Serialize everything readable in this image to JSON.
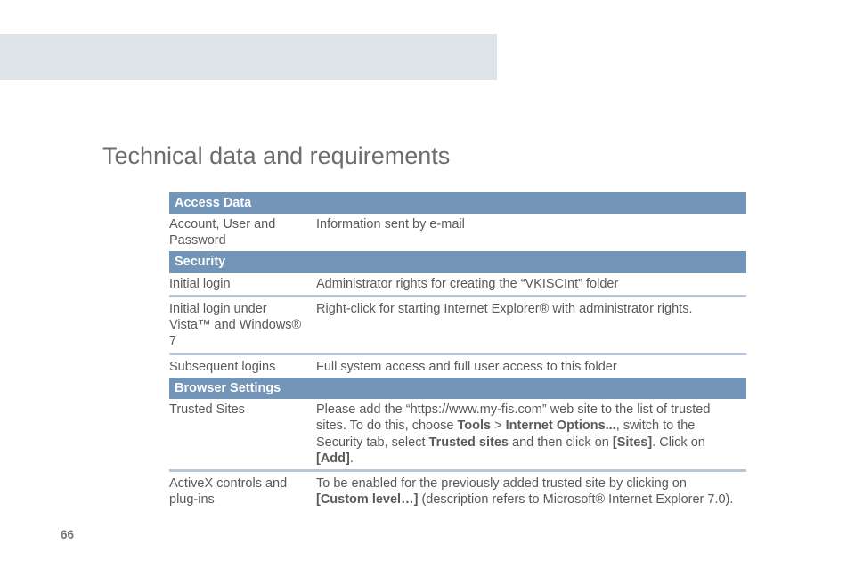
{
  "pageNumber": "66",
  "title": "Technical data and requirements",
  "sections": [
    {
      "type": "header",
      "label": "Access Data"
    },
    {
      "type": "row",
      "col1": "Account, User and Password",
      "col2": "Information sent by e-mail"
    },
    {
      "type": "header",
      "label": "Security"
    },
    {
      "type": "row",
      "col1": "Initial login",
      "col2": "Administrator rights for creating the “VKISCInt” folder"
    },
    {
      "type": "row",
      "col1": "Initial login under Vista™ and Windows® 7",
      "col2": "Right-click for starting Internet Explorer® with administrator rights."
    },
    {
      "type": "row",
      "col1": "Subsequent logins",
      "col2": "Full system access and full user access to this folder"
    },
    {
      "type": "header",
      "label": "Browser Settings"
    },
    {
      "type": "row-html",
      "col1": "Trusted Sites",
      "col2": "Please add the “https://www.my-fis.com” web site to the list of trusted sites. To do this, choose <b>Tools</b> > <b>Internet Options...</b>, switch to the Security tab, select <b>Trusted sites</b> and then click on <b>[Sites]</b>. Click on <b>[Add]</b>."
    },
    {
      "type": "row-html",
      "col1": "ActiveX controls and plug-ins",
      "col2": "To be enabled for the previously added trusted site by clicking on <b>[Custom level…]</b> (description refers to Microsoft® Internet Explorer 7.0)."
    }
  ]
}
